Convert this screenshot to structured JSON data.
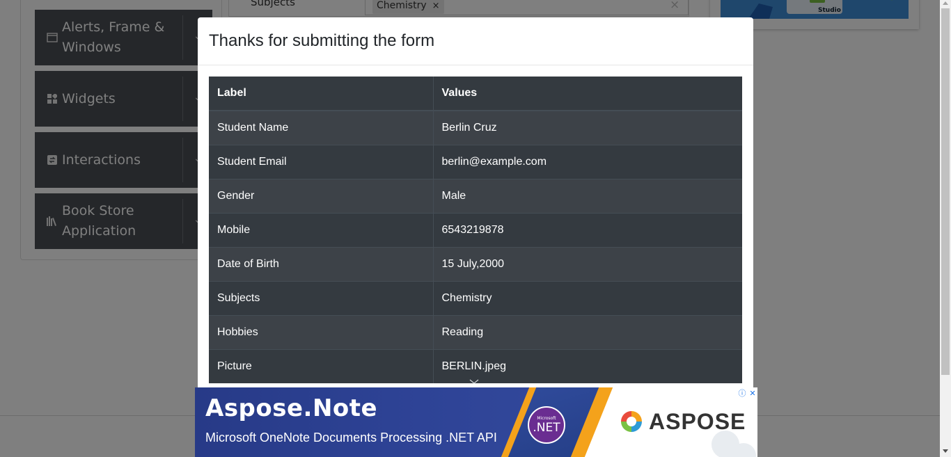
{
  "background": {
    "groups": [
      {
        "title": "Alerts, Frame & Windows",
        "icon": "window-icon"
      },
      {
        "title": "Widgets",
        "icon": "widgets-icon"
      },
      {
        "title": "Interactions",
        "icon": "interactions-icon"
      },
      {
        "title": "Book Store Application",
        "icon": "books-icon"
      }
    ],
    "form": {
      "subjects_label": "Subjects",
      "chip_label": "Chemistry",
      "chip_remove": "×",
      "clear_all": "×"
    },
    "banner_text": "Studio"
  },
  "modal": {
    "title": "Thanks for submitting the form",
    "table": {
      "headers": [
        "Label",
        "Values"
      ],
      "rows": [
        {
          "label": "Student Name",
          "value": "Berlin Cruz"
        },
        {
          "label": "Student Email",
          "value": "berlin@example.com"
        },
        {
          "label": "Gender",
          "value": "Male"
        },
        {
          "label": "Mobile",
          "value": "6543219878"
        },
        {
          "label": "Date of Birth",
          "value": "15 July,2000"
        },
        {
          "label": "Subjects",
          "value": "Chemistry"
        },
        {
          "label": "Hobbies",
          "value": "Reading"
        },
        {
          "label": "Picture",
          "value": "BERLIN.jpeg"
        }
      ]
    }
  },
  "ad": {
    "title": "Aspose.Note",
    "subtitle": "Microsoft OneNote Documents Processing .NET API",
    "badge_top": "Microsoft",
    "badge_main": ".NET",
    "brand": "ASPOSE",
    "info_icon": "ⓘ",
    "close_icon": "✕"
  },
  "colors": {
    "overlay": "#00000080",
    "table_bg": "#343a40",
    "sidebar_group": "#4a4f55",
    "ad_blue": "#2e4396",
    "ad_orange": "#f4a21b"
  }
}
